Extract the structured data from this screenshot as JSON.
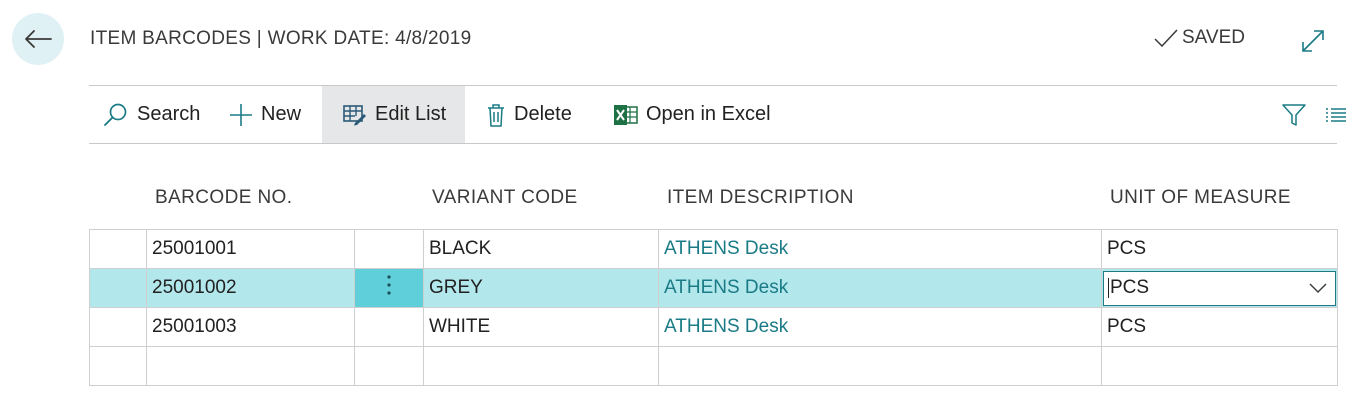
{
  "header": {
    "title": "ITEM BARCODES | WORK DATE: 4/8/2019",
    "status": "SAVED"
  },
  "toolbar": {
    "search_label": "Search",
    "new_label": "New",
    "edit_list_label": "Edit List",
    "delete_label": "Delete",
    "excel_label": "Open in Excel"
  },
  "columns": {
    "barcode_no": "BARCODE NO.",
    "variant_code": "VARIANT CODE",
    "item_description": "ITEM DESCRIPTION",
    "unit_of_measure": "UNIT OF MEASURE"
  },
  "rows": [
    {
      "barcode": "25001001",
      "variant": "BLACK",
      "description": "ATHENS Desk",
      "uom": "PCS"
    },
    {
      "barcode": "25001002",
      "variant": "GREY",
      "description": "ATHENS Desk",
      "uom": "PCS"
    },
    {
      "barcode": "25001003",
      "variant": "WHITE",
      "description": "ATHENS Desk",
      "uom": "PCS"
    }
  ],
  "colors": {
    "accent": "#1a7b86",
    "selected_row": "#b2e7ec",
    "row_menu": "#5fcfd9",
    "back_button_bg": "#dff1f4"
  },
  "icons": [
    "back-arrow-icon",
    "checkmark-icon",
    "expand-icon",
    "search-icon",
    "plus-icon",
    "edit-list-icon",
    "trash-icon",
    "excel-icon",
    "filter-icon",
    "list-view-icon",
    "row-menu-icon",
    "chevron-down-icon"
  ]
}
